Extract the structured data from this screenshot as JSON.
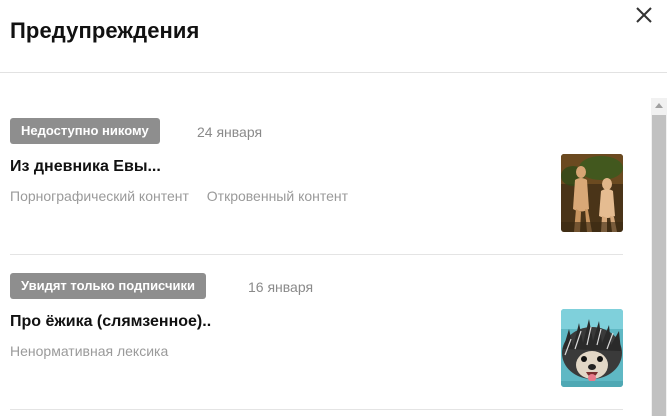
{
  "dialog": {
    "title": "Предупреждения",
    "close_icon": "close-icon"
  },
  "warnings": [
    {
      "status": "Недоступно никому",
      "date": "24 января",
      "title": "Из дневника Евы...",
      "reasons": [
        "Порнографический контент",
        "Откровенный контент"
      ],
      "thumbnail": "painting-thumbnail"
    },
    {
      "status": "Увидят только подписчики",
      "date": "16 января",
      "title": "Про ёжика (слямзенное)..",
      "reasons": [
        "Ненормативная лексика"
      ],
      "thumbnail": "hedgehog-thumbnail"
    }
  ],
  "colors": {
    "badge_bg": "#8e8e8e",
    "muted_text": "#9a9a9a",
    "divider": "#e4e4e4",
    "scrollbar_thumb": "#c1c1c1"
  }
}
